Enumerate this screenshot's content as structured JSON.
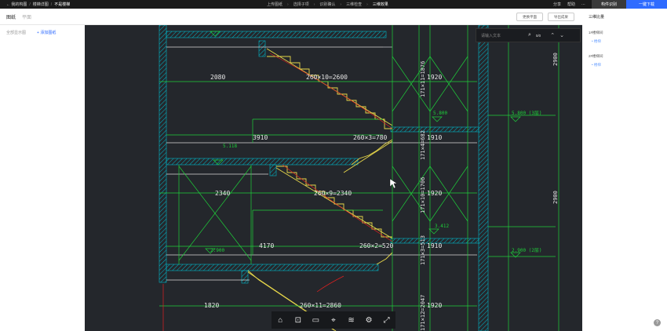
{
  "topbar": {
    "breadcrumbs": [
      "← 我的构图",
      "楼梯详图",
      "不是楼梯"
    ],
    "steps": [
      "上传图纸",
      "选择子项",
      "识别确认",
      "三维检查",
      "三维效果"
    ],
    "right_links": [
      "分享",
      "帮助"
    ],
    "dark_button": "构件识别",
    "primary_button": "一键下载"
  },
  "subbar": {
    "tabs": [
      "图纸",
      "平面"
    ],
    "buttons": [
      "更换平面",
      "导出成果"
    ]
  },
  "left_panel": {
    "filter_label": "全部显示图",
    "add_label": "+ 添加图纸"
  },
  "search": {
    "placeholder": "请输入文本",
    "count": "0/0"
  },
  "right_panel": {
    "title": "三维比量",
    "groups": [
      {
        "label": "1#楼梯间",
        "item": "• 楼梯"
      },
      {
        "label": "2#楼梯间",
        "item": "• 楼梯"
      }
    ]
  },
  "drawing": {
    "dims": [
      "2080",
      "260×10=2600",
      "1920",
      "3910",
      "260×3=780",
      "1910",
      "2340",
      "260×9=2340",
      "1920",
      "4170",
      "260×2=520",
      "1910",
      "1820",
      "260×11=2860",
      "1920"
    ],
    "vert_dims": [
      "171×11=1876",
      "171×4=682",
      "171×10=1706",
      "171×3=513",
      "171×12=2047"
    ],
    "right_dims": [
      "2900",
      "2900"
    ],
    "levels": [
      "5.800",
      "5.800 (3层)",
      "5.118",
      "3.412",
      "2.900 (2层)",
      "2.900"
    ]
  },
  "toolbar": {
    "tools": [
      "home-icon",
      "zoom-region-icon",
      "measure-icon",
      "section-icon",
      "layers-icon",
      "settings-icon",
      "fullscreen-icon"
    ],
    "glyphs": [
      "⌂",
      "⊡",
      "▭",
      "⌖",
      "≋",
      "⚙",
      "⤢"
    ]
  }
}
